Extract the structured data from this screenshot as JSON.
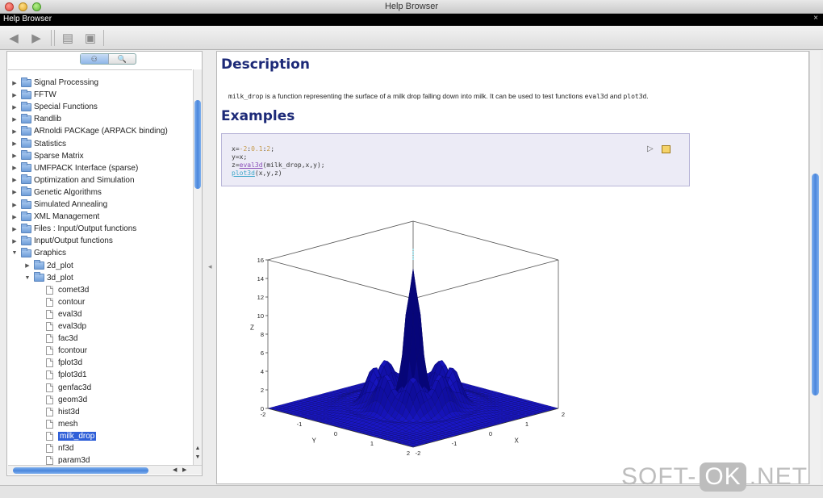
{
  "window": {
    "title": "Help Browser"
  },
  "menubar": {
    "label": "Help Browser",
    "close": "×"
  },
  "toolbar": {
    "back": "◀",
    "forward": "▶",
    "print": "▤",
    "page_setup": "▣"
  },
  "sidebar": {
    "segmented": [
      "⚇",
      "🔍"
    ],
    "items": [
      {
        "label": "Signal Processing",
        "level": 0,
        "kind": "folder",
        "open": false
      },
      {
        "label": "FFTW",
        "level": 0,
        "kind": "folder",
        "open": false
      },
      {
        "label": "Special Functions",
        "level": 0,
        "kind": "folder",
        "open": false
      },
      {
        "label": "Randlib",
        "level": 0,
        "kind": "folder",
        "open": false
      },
      {
        "label": "ARnoldi PACKage (ARPACK binding)",
        "level": 0,
        "kind": "folder",
        "open": false
      },
      {
        "label": "Statistics",
        "level": 0,
        "kind": "folder",
        "open": false
      },
      {
        "label": "Sparse Matrix",
        "level": 0,
        "kind": "folder",
        "open": false
      },
      {
        "label": "UMFPACK Interface (sparse)",
        "level": 0,
        "kind": "folder",
        "open": false
      },
      {
        "label": "Optimization and Simulation",
        "level": 0,
        "kind": "folder",
        "open": false
      },
      {
        "label": "Genetic Algorithms",
        "level": 0,
        "kind": "folder",
        "open": false
      },
      {
        "label": "Simulated Annealing",
        "level": 0,
        "kind": "folder",
        "open": false
      },
      {
        "label": "XML Management",
        "level": 0,
        "kind": "folder",
        "open": false
      },
      {
        "label": "Files : Input/Output functions",
        "level": 0,
        "kind": "folder",
        "open": false
      },
      {
        "label": "Input/Output functions",
        "level": 0,
        "kind": "folder",
        "open": false
      },
      {
        "label": "Graphics",
        "level": 0,
        "kind": "folder",
        "open": true
      },
      {
        "label": "2d_plot",
        "level": 1,
        "kind": "folder",
        "open": false
      },
      {
        "label": "3d_plot",
        "level": 1,
        "kind": "folder",
        "open": true
      },
      {
        "label": "comet3d",
        "level": 2,
        "kind": "doc"
      },
      {
        "label": "contour",
        "level": 2,
        "kind": "doc"
      },
      {
        "label": "eval3d",
        "level": 2,
        "kind": "doc"
      },
      {
        "label": "eval3dp",
        "level": 2,
        "kind": "doc"
      },
      {
        "label": "fac3d",
        "level": 2,
        "kind": "doc"
      },
      {
        "label": "fcontour",
        "level": 2,
        "kind": "doc"
      },
      {
        "label": "fplot3d",
        "level": 2,
        "kind": "doc"
      },
      {
        "label": "fplot3d1",
        "level": 2,
        "kind": "doc"
      },
      {
        "label": "genfac3d",
        "level": 2,
        "kind": "doc"
      },
      {
        "label": "geom3d",
        "level": 2,
        "kind": "doc"
      },
      {
        "label": "hist3d",
        "level": 2,
        "kind": "doc"
      },
      {
        "label": "mesh",
        "level": 2,
        "kind": "doc"
      },
      {
        "label": "milk_drop",
        "level": 2,
        "kind": "doc",
        "selected": true
      },
      {
        "label": "nf3d",
        "level": 2,
        "kind": "doc"
      },
      {
        "label": "param3d",
        "level": 2,
        "kind": "doc"
      }
    ]
  },
  "content": {
    "description_heading": "Description",
    "description_code": "milk_drop",
    "description_text": " is a function representing the surface of a milk drop falling down into milk. It can be used to test functions ",
    "description_code2": "eval3d",
    "description_and": " and ",
    "description_code3": "plot3d",
    "description_end": ".",
    "examples_heading": "Examples",
    "code": {
      "l1_a": "x=",
      "l1_b": "-2",
      "l1_c": ":",
      "l1_d": "0.1",
      "l1_e": ":",
      "l1_f": "2",
      "l1_g": ";",
      "l2": "y=x;",
      "l3_a": "z=",
      "l3_b": "eval3d",
      "l3_c": "(milk_drop,x,y);",
      "l4_a": "plot3d",
      "l4_b": "(x,y,z)"
    },
    "run_icon": "▷"
  },
  "chart_data": {
    "type": "surface3d",
    "title": "",
    "xlabel": "X",
    "ylabel": "Y",
    "zlabel": "Z",
    "x_ticks": [
      "-2",
      "-1",
      "0",
      "1",
      "2"
    ],
    "y_ticks": [
      "-2",
      "-1",
      "0",
      "1",
      "2"
    ],
    "z_ticks": [
      "0",
      "2",
      "4",
      "6",
      "8",
      "10",
      "12",
      "14",
      "16"
    ],
    "zlim": [
      0,
      16
    ],
    "surface_color": "#1a17c9",
    "peak_z": 15
  },
  "watermark": {
    "a": "SOFT-",
    "b": "OK",
    "c": ".NET"
  }
}
